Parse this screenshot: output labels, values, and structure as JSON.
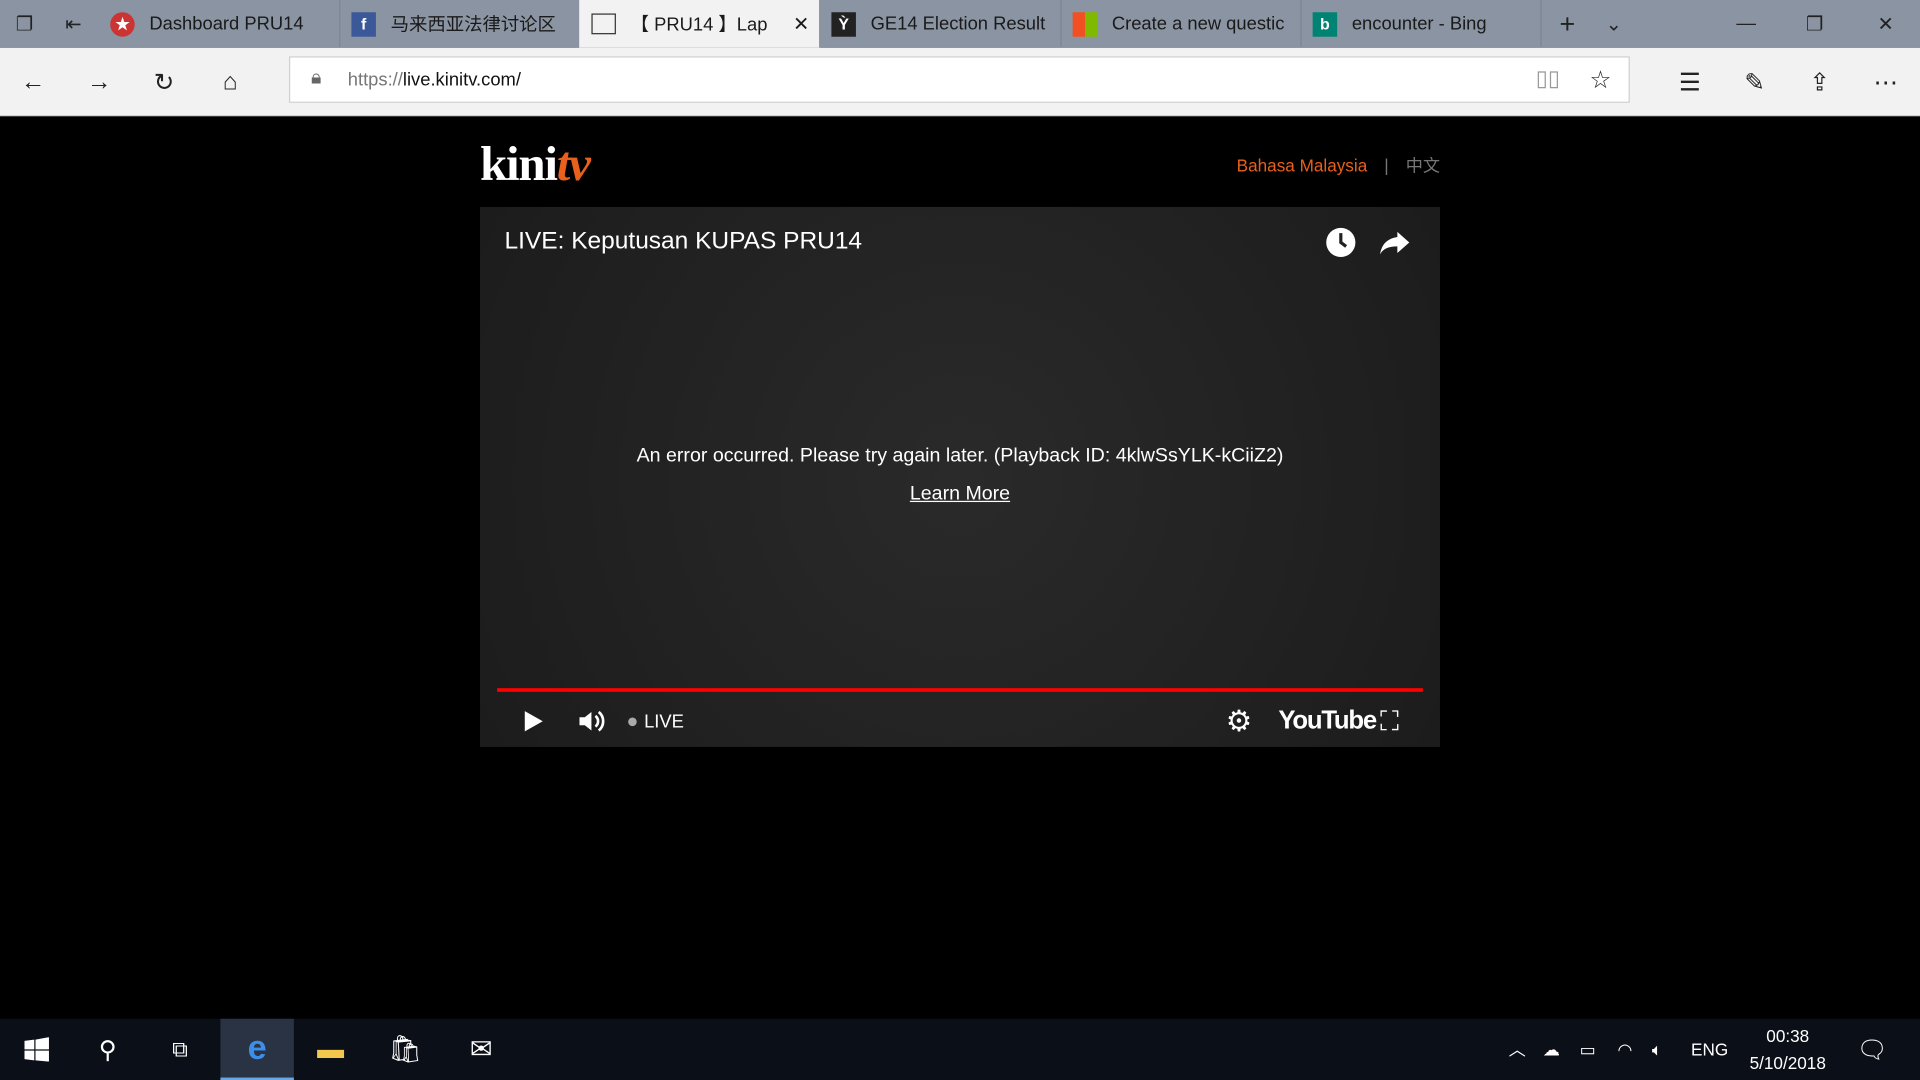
{
  "browser": {
    "tabs": [
      {
        "title": "Dashboard PRU14",
        "icon": "flag-favicon"
      },
      {
        "title": "马来西亚法律讨论区",
        "icon": "facebook-favicon"
      },
      {
        "title": "【 PRU14 】Lap",
        "icon": "page-favicon",
        "active": true
      },
      {
        "title": "GE14 Election Result",
        "icon": "logo-favicon"
      },
      {
        "title": "Create a new questic",
        "icon": "microsoft-favicon"
      },
      {
        "title": "encounter - Bing",
        "icon": "bing-favicon"
      }
    ],
    "url_scheme": "https://",
    "url_rest": "live.kinitv.com/"
  },
  "site": {
    "logo_main": "kini",
    "logo_accent": "tv",
    "lang_primary": "Bahasa Malaysia",
    "lang_sep": "|",
    "lang_secondary": "中文",
    "accent": "#e8601c"
  },
  "player": {
    "title": "LIVE: Keputusan KUPAS PRU14",
    "error": "An error occurred. Please try again later. (Playback ID: 4klwSsYLK-kCiiZ2)",
    "learn_more": "Learn More",
    "live_label": "LIVE",
    "brand": "YouTube",
    "progress_color": "#ff0000"
  },
  "taskbar": {
    "lang": "ENG",
    "time": "00:38",
    "date": "5/10/2018"
  }
}
